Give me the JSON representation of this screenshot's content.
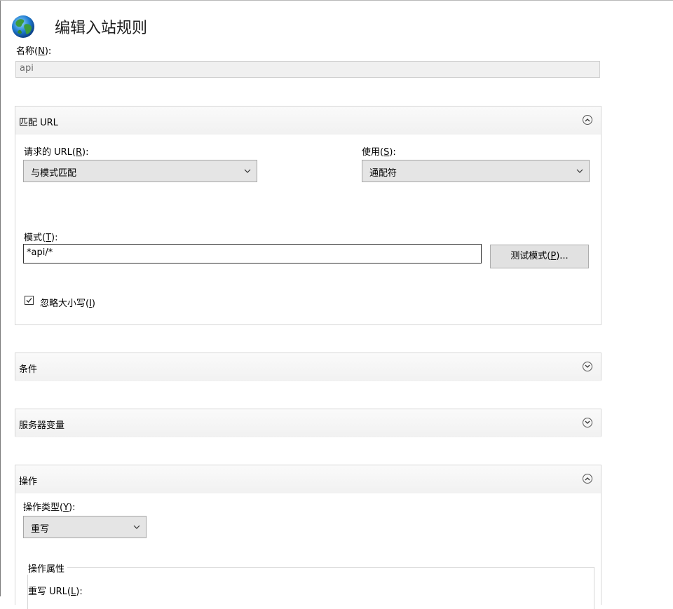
{
  "dialog": {
    "title": "编辑入站规则",
    "name_label_prefix": "名称(",
    "name_label_key": "N",
    "name_label_suffix": "):",
    "name_value": "api"
  },
  "match_url": {
    "title": "匹配 URL",
    "requested_url_label_prefix": "请求的 URL(",
    "requested_url_label_key": "R",
    "requested_url_label_suffix": "):",
    "requested_url_value": "与模式匹配",
    "using_label_prefix": "使用(",
    "using_label_key": "S",
    "using_label_suffix": "):",
    "using_value": "通配符",
    "pattern_label_prefix": "模式(",
    "pattern_label_key": "T",
    "pattern_label_suffix": "):",
    "pattern_value": "*api/*",
    "test_button_prefix": "测试模式(",
    "test_button_key": "P",
    "test_button_suffix": ")...",
    "ignore_case_prefix": "忽略大小写(",
    "ignore_case_key": "I",
    "ignore_case_suffix": ")",
    "ignore_case_checked": true
  },
  "conditions": {
    "title": "条件"
  },
  "server_variables": {
    "title": "服务器变量"
  },
  "action": {
    "title": "操作",
    "type_label_prefix": "操作类型(",
    "type_label_key": "Y",
    "type_label_suffix": "):",
    "type_value": "重写",
    "properties_legend": "操作属性",
    "rewrite_url_label_prefix": "重写 URL(",
    "rewrite_url_label_key": "L",
    "rewrite_url_label_suffix": "):"
  },
  "icons": {
    "globe": "globe-icon",
    "collapse": "chevron-up-circle-icon",
    "expand": "chevron-down-circle-icon",
    "dropdown": "chevron-down-icon",
    "check": "checkmark-icon"
  }
}
